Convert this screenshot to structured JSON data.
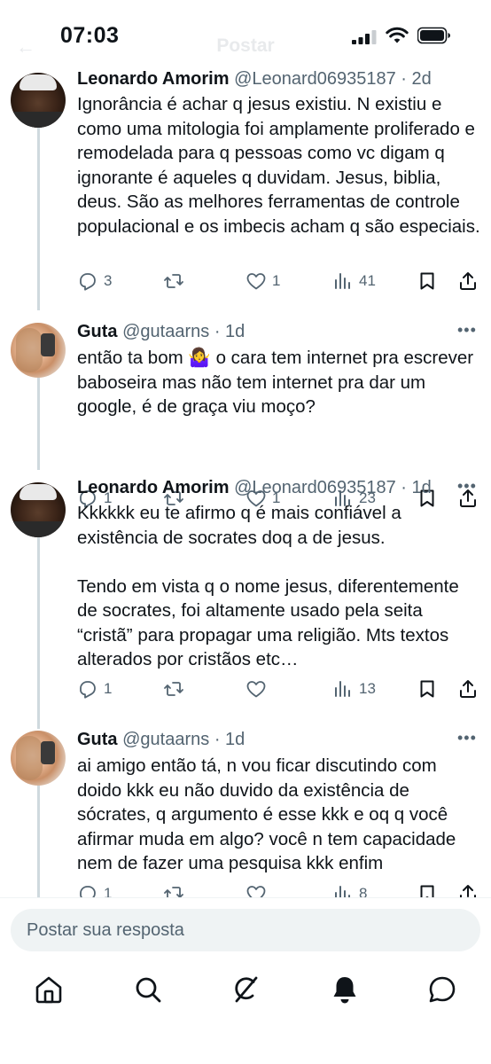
{
  "status_bar": {
    "time": "07:03"
  },
  "header": {
    "title": "Postar",
    "back": "←"
  },
  "tweets": [
    {
      "name": "Leonardo Amorim",
      "handle": "@Leonard06935187",
      "time": "2d",
      "avatar": "leonardo-avatar",
      "text": "Ignorância é achar q jesus existiu. N existiu e como uma mitologia foi amplamente proliferado e remodelada para q pessoas como vc digam q ignorante é aqueles q duvidam. Jesus, biblia, deus. São as melhores ferramentas de controle populacional e os imbecis acham q são especiais.",
      "replies": "3",
      "retweets": "",
      "likes": "1",
      "views": "41"
    },
    {
      "name": "Guta",
      "handle": "@gutaarns",
      "time": "1d",
      "avatar": "guta-avatar",
      "text": "então ta bom 🤷‍♀️ o cara tem internet pra escrever baboseira mas não tem internet pra dar um google, é de graça viu moço?",
      "replies": "1",
      "retweets": "",
      "likes": "1",
      "views": "23"
    },
    {
      "name": "Leonardo Amorim",
      "handle": "@Leonard06935187",
      "time": "1d",
      "avatar": "leonardo-avatar",
      "text": "Kkkkkk eu te afirmo q é mais confiável a existência de socrates doq a de jesus.\n\nTendo em vista q o nome jesus, diferentemente de socrates, foi altamente usado pela seita “cristã” para propagar uma religião. Mts textos alterados por cristãos etc…",
      "replies": "1",
      "retweets": "",
      "likes": "",
      "views": "13"
    },
    {
      "name": "Guta",
      "handle": "@gutaarns",
      "time": "1d",
      "avatar": "guta-avatar",
      "text": "ai amigo então tá, n vou ficar discutindo com doido kkk eu não duvido da existência de sócrates, q argumento é esse kkk e oq q você afirmar muda em algo? você n tem capacidade nem de fazer uma pesquisa kkk enfim",
      "replies": "1",
      "retweets": "",
      "likes": "",
      "views": "8"
    }
  ],
  "reply_box": {
    "placeholder": "Postar sua resposta"
  },
  "nav": [
    "home-icon",
    "search-icon",
    "grok-icon",
    "notifications-icon",
    "messages-icon"
  ],
  "colors": {
    "text": "#0f1419",
    "secondary": "#536471",
    "thread_line": "#cfd9de",
    "input_bg": "#eff3f4"
  }
}
